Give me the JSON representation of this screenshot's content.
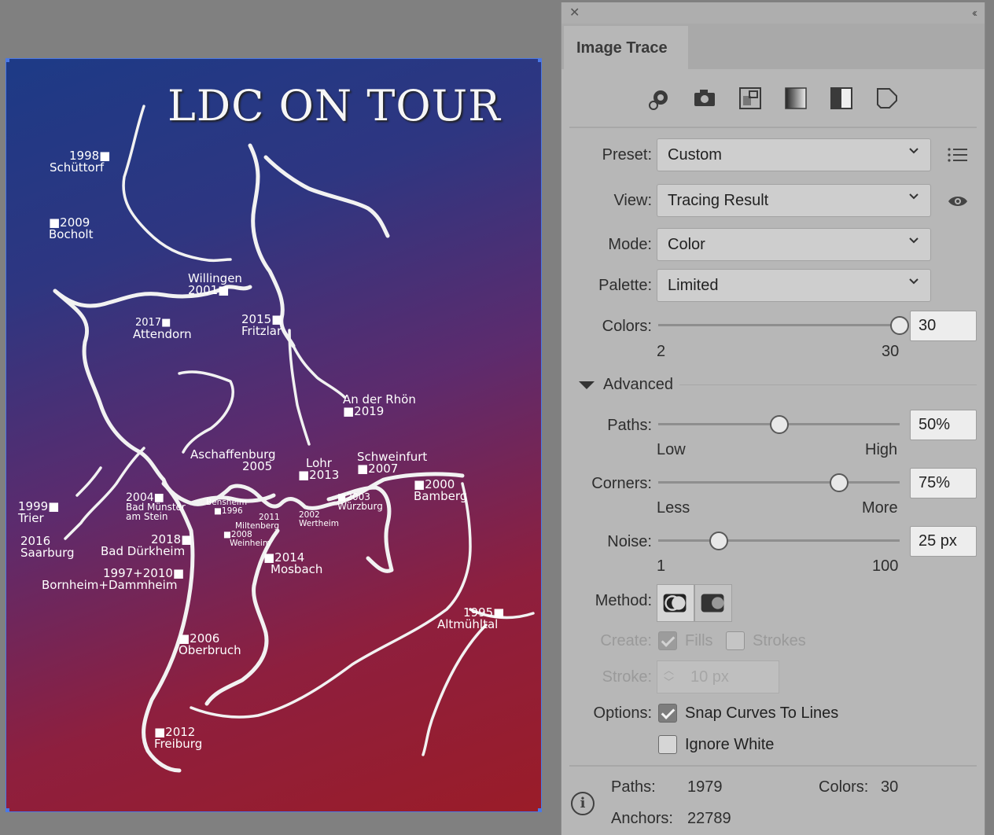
{
  "artwork": {
    "title": "LDC ON TOUR",
    "cities": [
      {
        "id": "schuttorf",
        "l1": "1998■",
        "l2": "Schüttorf"
      },
      {
        "id": "bocholt",
        "l1": "■2009",
        "l2": "Bocholt"
      },
      {
        "id": "willingen",
        "l1": "Willingen",
        "l2": "2001■"
      },
      {
        "id": "attendorn",
        "l1": "2017■",
        "l2": "Attendorn"
      },
      {
        "id": "fritzlar",
        "l1": "2015■",
        "l2": "Fritzlar"
      },
      {
        "id": "rhon",
        "l1": "An der Rhön",
        "l2": "■2019"
      },
      {
        "id": "aschaffenburg",
        "l1": "Aschaffenburg",
        "l2": "2005"
      },
      {
        "id": "lohr",
        "l1": "Lohr",
        "l2": "■2013"
      },
      {
        "id": "schweinfurt",
        "l1": "Schweinfurt",
        "l2": "■2007"
      },
      {
        "id": "bamberg",
        "l1": "■2000",
        "l2": "Bamberg"
      },
      {
        "id": "trier",
        "l1": "1999■",
        "l2": "Trier"
      },
      {
        "id": "muenster",
        "l1": "2004■",
        "l2": "Bad Münster",
        "l3": "am Stein"
      },
      {
        "id": "bensheim",
        "l1": "Bensheim",
        "l2": "■1996"
      },
      {
        "id": "miltenberg",
        "l1": "2011",
        "l2": "Miltenberg"
      },
      {
        "id": "wertheim",
        "l1": "2002",
        "l2": "Wertheim"
      },
      {
        "id": "wurzburg",
        "l1": "■2003",
        "l2": "Würzburg"
      },
      {
        "id": "weinheim",
        "l1": "■2008",
        "l2": "Weinheim"
      },
      {
        "id": "saarburg",
        "l1": "2016",
        "l2": "Saarburg"
      },
      {
        "id": "durkheim",
        "l1": "2018■",
        "l2": "Bad Dürkheim"
      },
      {
        "id": "mosbach",
        "l1": "■2014",
        "l2": "Mosbach"
      },
      {
        "id": "bornheim",
        "l1": "1997+2010■",
        "l2": "Bornheim+Dammheim"
      },
      {
        "id": "altmuhltal",
        "l1": "1995■",
        "l2": "Altmühltal"
      },
      {
        "id": "oberbruch",
        "l1": "■2006",
        "l2": "Oberbruch"
      },
      {
        "id": "freiburg",
        "l1": "■2012",
        "l2": "Freiburg"
      }
    ]
  },
  "panel": {
    "tab": "Image Trace",
    "preset": {
      "label": "Preset:",
      "value": "Custom"
    },
    "view": {
      "label": "View:",
      "value": "Tracing Result"
    },
    "mode": {
      "label": "Mode:",
      "value": "Color"
    },
    "palette": {
      "label": "Palette:",
      "value": "Limited"
    },
    "colors": {
      "label": "Colors:",
      "value": "30",
      "min": "2",
      "max": "30",
      "level": 1.0
    },
    "advanced": "Advanced",
    "paths": {
      "label": "Paths:",
      "value": "50%",
      "low": "Low",
      "high": "High",
      "level": 0.5
    },
    "corners": {
      "label": "Corners:",
      "value": "75%",
      "low": "Less",
      "high": "More",
      "level": 0.75
    },
    "noise": {
      "label": "Noise:",
      "value": "25 px",
      "low": "1",
      "high": "100",
      "level": 0.25
    },
    "method": {
      "label": "Method:"
    },
    "create": {
      "label": "Create:",
      "fills": "Fills",
      "strokes": "Strokes"
    },
    "stroke": {
      "label": "Stroke:",
      "value": "10 px"
    },
    "options": {
      "label": "Options:",
      "snap": "Snap Curves To Lines",
      "ignore_white": "Ignore White"
    },
    "stats": {
      "paths_label": "Paths:",
      "paths_value": "1979",
      "colors_label": "Colors:",
      "colors_value": "30",
      "anchors_label": "Anchors:",
      "anchors_value": "22789"
    }
  }
}
